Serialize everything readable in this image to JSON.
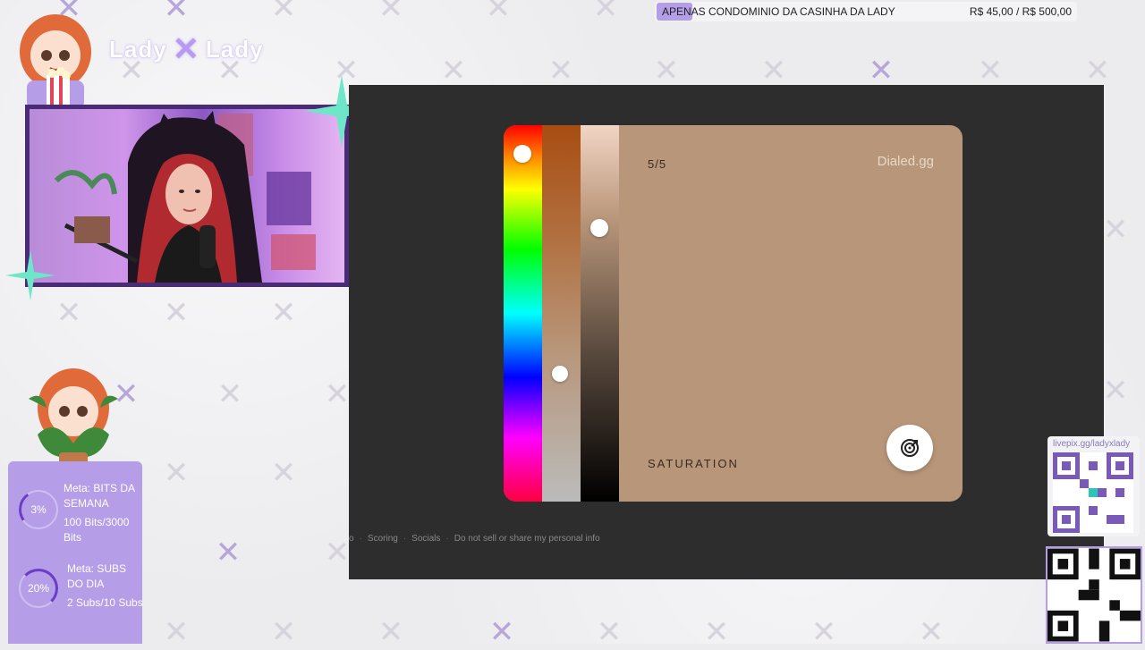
{
  "banner": {
    "title": "APENAS CONDOMINIO DA CASINHA DA LADY",
    "amount": "R$ 45,00 / R$ 500,00"
  },
  "logo": {
    "left": "Lady",
    "x": "✕",
    "right": "Lady"
  },
  "card": {
    "counter": "5/5",
    "brand": "Dialed.gg",
    "mode": "SATURATION"
  },
  "footer": {
    "links": [
      "o",
      "Scoring",
      "Socials",
      "Do not sell or share my personal info"
    ]
  },
  "goals": [
    {
      "title": "Meta: BITS DA SEMANA",
      "percent": "3%",
      "progress": 0.03,
      "amount": "100 Bits/3000 Bits"
    },
    {
      "title": "Meta: SUBS DO DIA",
      "percent": "20%",
      "progress": 0.2,
      "amount": "2 Subs/10 Subs"
    }
  ],
  "qr": {
    "url": "livepix.gg/ladyxlady"
  },
  "colors": {
    "accent": "#b59de8",
    "panel": "#2d2d2d",
    "target_color": "#b8967a"
  }
}
